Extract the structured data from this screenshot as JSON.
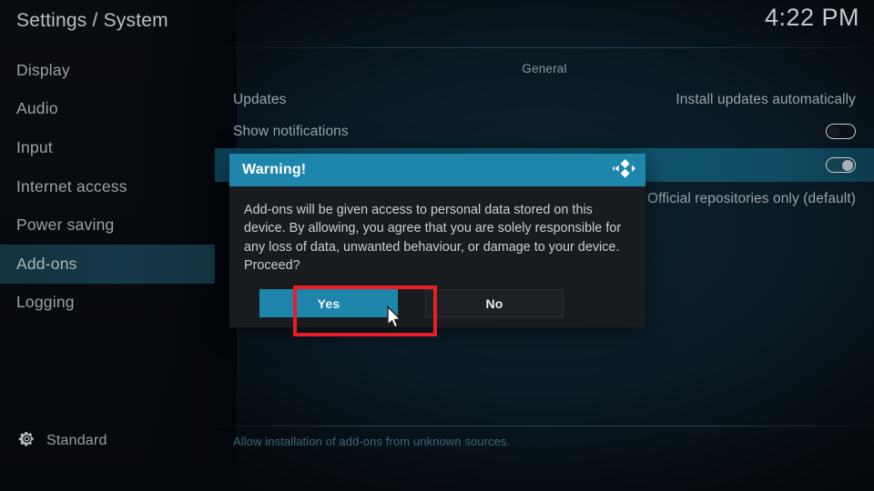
{
  "header": {
    "title": "Settings / System",
    "clock": "4:22 PM"
  },
  "sidebar": {
    "items": [
      {
        "label": "Display",
        "selected": false
      },
      {
        "label": "Audio",
        "selected": false
      },
      {
        "label": "Input",
        "selected": false
      },
      {
        "label": "Internet access",
        "selected": false
      },
      {
        "label": "Power saving",
        "selected": false
      },
      {
        "label": "Add-ons",
        "selected": true
      },
      {
        "label": "Logging",
        "selected": false
      }
    ],
    "status": {
      "icon": "gear-icon",
      "label": "Standard"
    }
  },
  "content": {
    "section_header": "General",
    "rows": [
      {
        "label": "Updates",
        "value": "Install updates automatically",
        "control": "text",
        "state": ""
      },
      {
        "label": "Show notifications",
        "value": "",
        "control": "toggle",
        "state": "off"
      },
      {
        "label": "",
        "value": "",
        "control": "toggle",
        "state": "on"
      },
      {
        "label": "",
        "value": "Official repositories only (default)",
        "control": "text",
        "state": ""
      }
    ],
    "footer_help": "Allow installation of add-ons from unknown sources."
  },
  "dialog": {
    "title": "Warning!",
    "logo_icon": "kodi-logo-icon",
    "message": "Add-ons will be given access to personal data stored on this device. By allowing, you agree that you are solely responsible for any loss of data, unwanted behaviour, or damage to your device. Proceed?",
    "buttons": {
      "confirm": "Yes",
      "cancel": "No"
    }
  },
  "annotation": {
    "color": "#ec1c24",
    "target": "yes-button"
  },
  "colors": {
    "accent": "#1e86ab",
    "highlight_row": "#115a75",
    "sidebar_selected": "#14394a",
    "annotation_red": "#ec1c24"
  }
}
